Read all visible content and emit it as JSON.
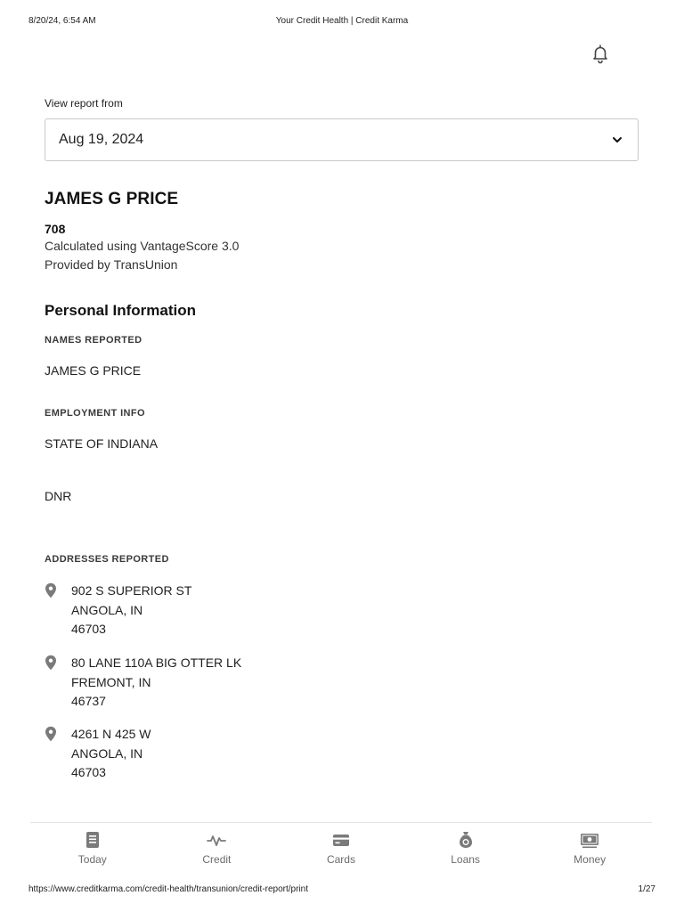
{
  "print": {
    "datetime": "8/20/24, 6:54 AM",
    "title": "Your Credit Health | Credit Karma",
    "url": "https://www.creditkarma.com/credit-health/transunion/credit-report/print",
    "page": "1/27"
  },
  "report_selector": {
    "label": "View report from",
    "selected": "Aug 19, 2024"
  },
  "profile": {
    "name": "JAMES G PRICE",
    "score": "708",
    "calculated": "Calculated using VantageScore 3.0",
    "provider": "Provided by TransUnion"
  },
  "personal_info": {
    "title": "Personal Information",
    "names_header": "NAMES REPORTED",
    "names": [
      "JAMES G PRICE"
    ],
    "employment_header": "EMPLOYMENT INFO",
    "employment": [
      "STATE OF INDIANA",
      "DNR"
    ],
    "addresses_header": "ADDRESSES REPORTED",
    "addresses": [
      {
        "line1": "902 S SUPERIOR ST",
        "line2": "ANGOLA, IN",
        "zip": "46703"
      },
      {
        "line1": "80 LANE 110A BIG OTTER LK",
        "line2": "FREMONT, IN",
        "zip": "46737"
      },
      {
        "line1": "4261 N 425 W",
        "line2": "ANGOLA, IN",
        "zip": "46703"
      }
    ]
  },
  "nav": {
    "items": [
      {
        "label": "Today",
        "icon": "today-icon"
      },
      {
        "label": "Credit",
        "icon": "credit-pulse-icon"
      },
      {
        "label": "Cards",
        "icon": "cards-icon"
      },
      {
        "label": "Loans",
        "icon": "money-bag-icon"
      },
      {
        "label": "Money",
        "icon": "cash-icon"
      }
    ]
  },
  "colors": {
    "icon_gray": "#7a7a7a",
    "border": "#c9c9c9",
    "text": "#1f1f1f"
  }
}
